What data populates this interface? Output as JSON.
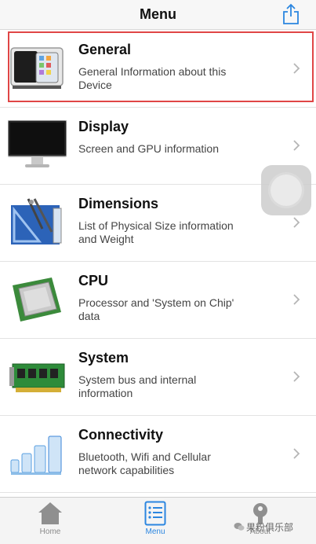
{
  "navbar": {
    "title": "Menu",
    "share_icon": "share-icon"
  },
  "accent_color": "#2b86e0",
  "highlight_color": "#e04646",
  "menu": {
    "items": [
      {
        "title": "General",
        "description": "General Information about this Device",
        "icon": "phone-device-icon"
      },
      {
        "title": "Display",
        "description": "Screen and GPU information",
        "icon": "monitor-icon"
      },
      {
        "title": "Dimensions",
        "description": "List of Physical Size information and Weight",
        "icon": "blueprint-tools-icon"
      },
      {
        "title": "CPU",
        "description": "Processor and 'System on Chip' data",
        "icon": "cpu-chip-icon"
      },
      {
        "title": "System",
        "description": "System bus and internal information",
        "icon": "circuit-board-icon"
      },
      {
        "title": "Connectivity",
        "description": "Bluetooth, Wifi and Cellular network capabilities",
        "icon": "signal-bars-icon"
      }
    ]
  },
  "tabbar": {
    "tabs": [
      {
        "label": "Home",
        "icon": "home-icon"
      },
      {
        "label": "Menu",
        "icon": "list-icon"
      },
      {
        "label": "About",
        "icon": "about-icon"
      }
    ]
  },
  "watermark": {
    "text": "果粉俱乐部"
  }
}
